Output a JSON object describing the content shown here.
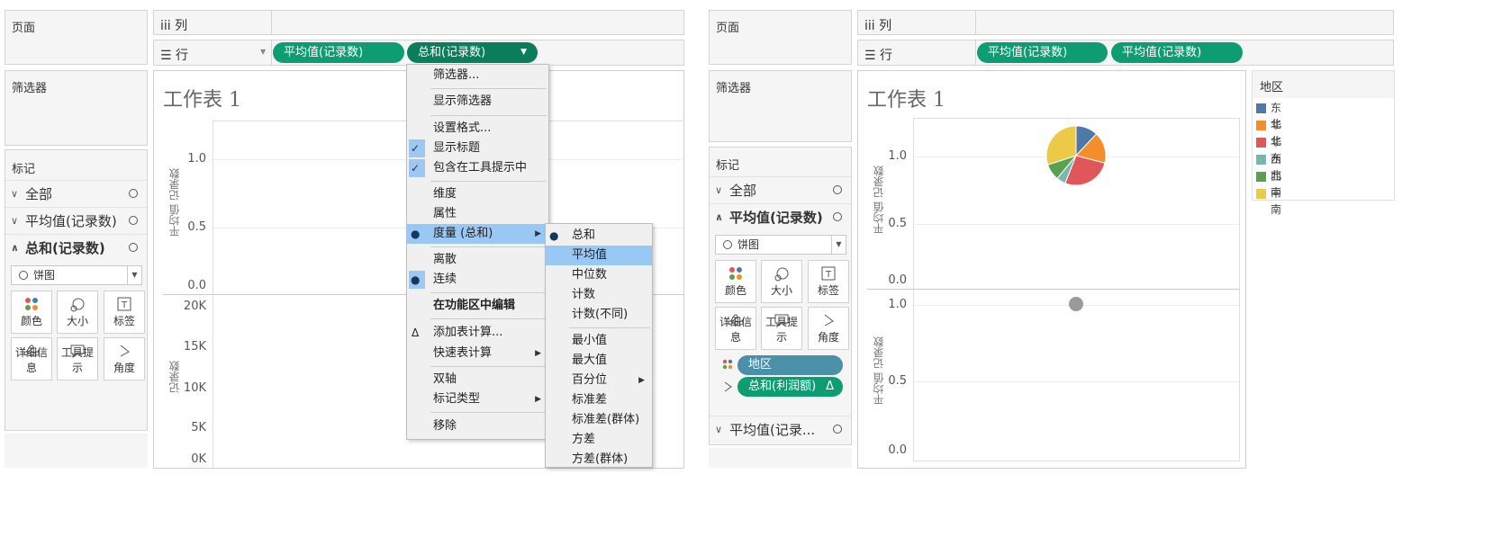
{
  "left": {
    "pages_label": "页面",
    "columns_label": "iii 列",
    "rows_label": "☰ 行",
    "row_pills": [
      "平均值(记录数)",
      "总和(记录数)"
    ],
    "filters_label": "筛选器",
    "marks_label": "标记",
    "marks_rows": [
      "全部",
      "平均值(记录数)",
      "总和(记录数)"
    ],
    "mark_type": "饼图",
    "mark_buttons": [
      "颜色",
      "大小",
      "标签",
      "详细信息",
      "工具提示",
      "角度"
    ],
    "sheet_title": "工作表 1",
    "top_axis_title": "平均值 记录数",
    "top_ticks": [
      "1.0",
      "0.5",
      "0.0"
    ],
    "bottom_axis_title": "记录数",
    "bottom_ticks": [
      "20K",
      "15K",
      "10K",
      "5K",
      "0K"
    ]
  },
  "context_menu": {
    "items": [
      {
        "label": "筛选器..."
      },
      {
        "label": "显示筛选器"
      },
      {
        "label": "设置格式..."
      },
      {
        "label": "显示标题",
        "mark": "✓"
      },
      {
        "label": "包含在工具提示中",
        "mark": "✓"
      },
      {
        "label": "维度"
      },
      {
        "label": "属性"
      },
      {
        "label": "度量 (总和)",
        "mark": "●",
        "submenu": true
      },
      {
        "label": "离散"
      },
      {
        "label": "连续",
        "mark": "●"
      },
      {
        "label": "在功能区中编辑"
      },
      {
        "label": "添加表计算...",
        "mark": "Δ"
      },
      {
        "label": "快速表计算",
        "submenu": true
      },
      {
        "label": "双轴"
      },
      {
        "label": "标记类型",
        "submenu": true
      },
      {
        "label": "移除"
      }
    ]
  },
  "sub_menu": {
    "items": [
      {
        "label": "总和",
        "mark": "●"
      },
      {
        "label": "平均值"
      },
      {
        "label": "中位数"
      },
      {
        "label": "计数"
      },
      {
        "label": "计数(不同)"
      },
      {
        "label": "最小值"
      },
      {
        "label": "最大值"
      },
      {
        "label": "百分位",
        "submenu": true
      },
      {
        "label": "标准差"
      },
      {
        "label": "标准差(群体)"
      },
      {
        "label": "方差"
      },
      {
        "label": "方差(群体)"
      }
    ]
  },
  "right": {
    "pages_label": "页面",
    "columns_label": "iii 列",
    "rows_label": "☰ 行",
    "row_pills": [
      "平均值(记录数)",
      "平均值(记录数)"
    ],
    "filters_label": "筛选器",
    "marks_label": "标记",
    "marks_rows": [
      "全部",
      "平均值(记录数)",
      "平均值(记录..."
    ],
    "mark_type": "饼图",
    "mark_buttons": [
      "颜色",
      "大小",
      "标签",
      "详细信息",
      "工具提示",
      "角度"
    ],
    "field_pills": [
      {
        "label": "地区",
        "icon": "color-dots",
        "color": "#4a90a8"
      },
      {
        "label": "总和(利润额)",
        "icon": "angle",
        "delta": "Δ",
        "color": "#0e9d73"
      }
    ],
    "sheet_title": "工作表 1",
    "top_axis_title": "平均值 记录数",
    "top_ticks": [
      "1.0",
      "0.5",
      "0.0"
    ],
    "bottom_axis_title": "平均值 记录数",
    "bottom_ticks": [
      "1.0",
      "0.5",
      "0.0"
    ],
    "legend_title": "地区",
    "legend": [
      {
        "label": "东北",
        "color": "#4e79a7"
      },
      {
        "label": "华北",
        "color": "#f28e2b"
      },
      {
        "label": "华东",
        "color": "#e15759"
      },
      {
        "label": "西北",
        "color": "#76b7b2"
      },
      {
        "label": "西南",
        "color": "#59a14f"
      },
      {
        "label": "中南",
        "color": "#edc948"
      }
    ]
  },
  "chart_data": {
    "type": "pie",
    "categories": [
      "东北",
      "华北",
      "华东",
      "西北",
      "西南",
      "中南"
    ],
    "values": [
      12,
      17,
      27,
      5,
      9,
      30
    ]
  },
  "colors": {
    "pill_green": "#0e9d73",
    "pill_blue": "#4a90a8",
    "highlight": "#99c8f5",
    "grey_point": "#9a9a9a"
  }
}
